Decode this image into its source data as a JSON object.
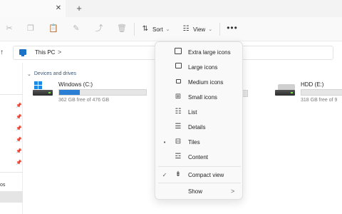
{
  "tabs": {
    "close_glyph": "✕",
    "add_glyph": "+"
  },
  "toolbar": {
    "sort_label": "Sort",
    "view_label": "View",
    "more_glyph": "•••",
    "chevron": "⌄"
  },
  "address": {
    "location": "This PC",
    "chevron": ">"
  },
  "content": {
    "section_title": "Devices and drives",
    "section_chevron": "⌄",
    "drives": [
      {
        "name": "Windows (C:)",
        "free_text": "362 GB free of 476 GB",
        "used_fraction": 0.24
      },
      {
        "name": "HDD (E:)",
        "free_text": "318 GB free of 9"
      }
    ]
  },
  "sidebar": {
    "partial_label": "os"
  },
  "view_menu": {
    "items": [
      {
        "label": "Extra large icons",
        "icon": "extra-large-icons-icon",
        "checked": false
      },
      {
        "label": "Large icons",
        "icon": "large-icons-icon",
        "checked": false
      },
      {
        "label": "Medium icons",
        "icon": "medium-icons-icon",
        "checked": false
      },
      {
        "label": "Small icons",
        "icon": "small-icons-icon",
        "checked": false
      },
      {
        "label": "List",
        "icon": "list-icon",
        "checked": false
      },
      {
        "label": "Details",
        "icon": "details-icon",
        "checked": false
      },
      {
        "label": "Tiles",
        "icon": "tiles-icon",
        "checked": true,
        "check_glyph": "•"
      },
      {
        "label": "Content",
        "icon": "content-icon",
        "checked": false
      },
      {
        "label": "Compact view",
        "icon": "compact-view-icon",
        "checked": true,
        "check_glyph": "✓"
      },
      {
        "label": "Show",
        "icon": "",
        "checked": false,
        "submenu_glyph": ">"
      }
    ]
  },
  "colors": {
    "accent": "#2a7fd4",
    "windows_blue": "#1e88e5",
    "menu_bg": "#f9f9f9"
  }
}
